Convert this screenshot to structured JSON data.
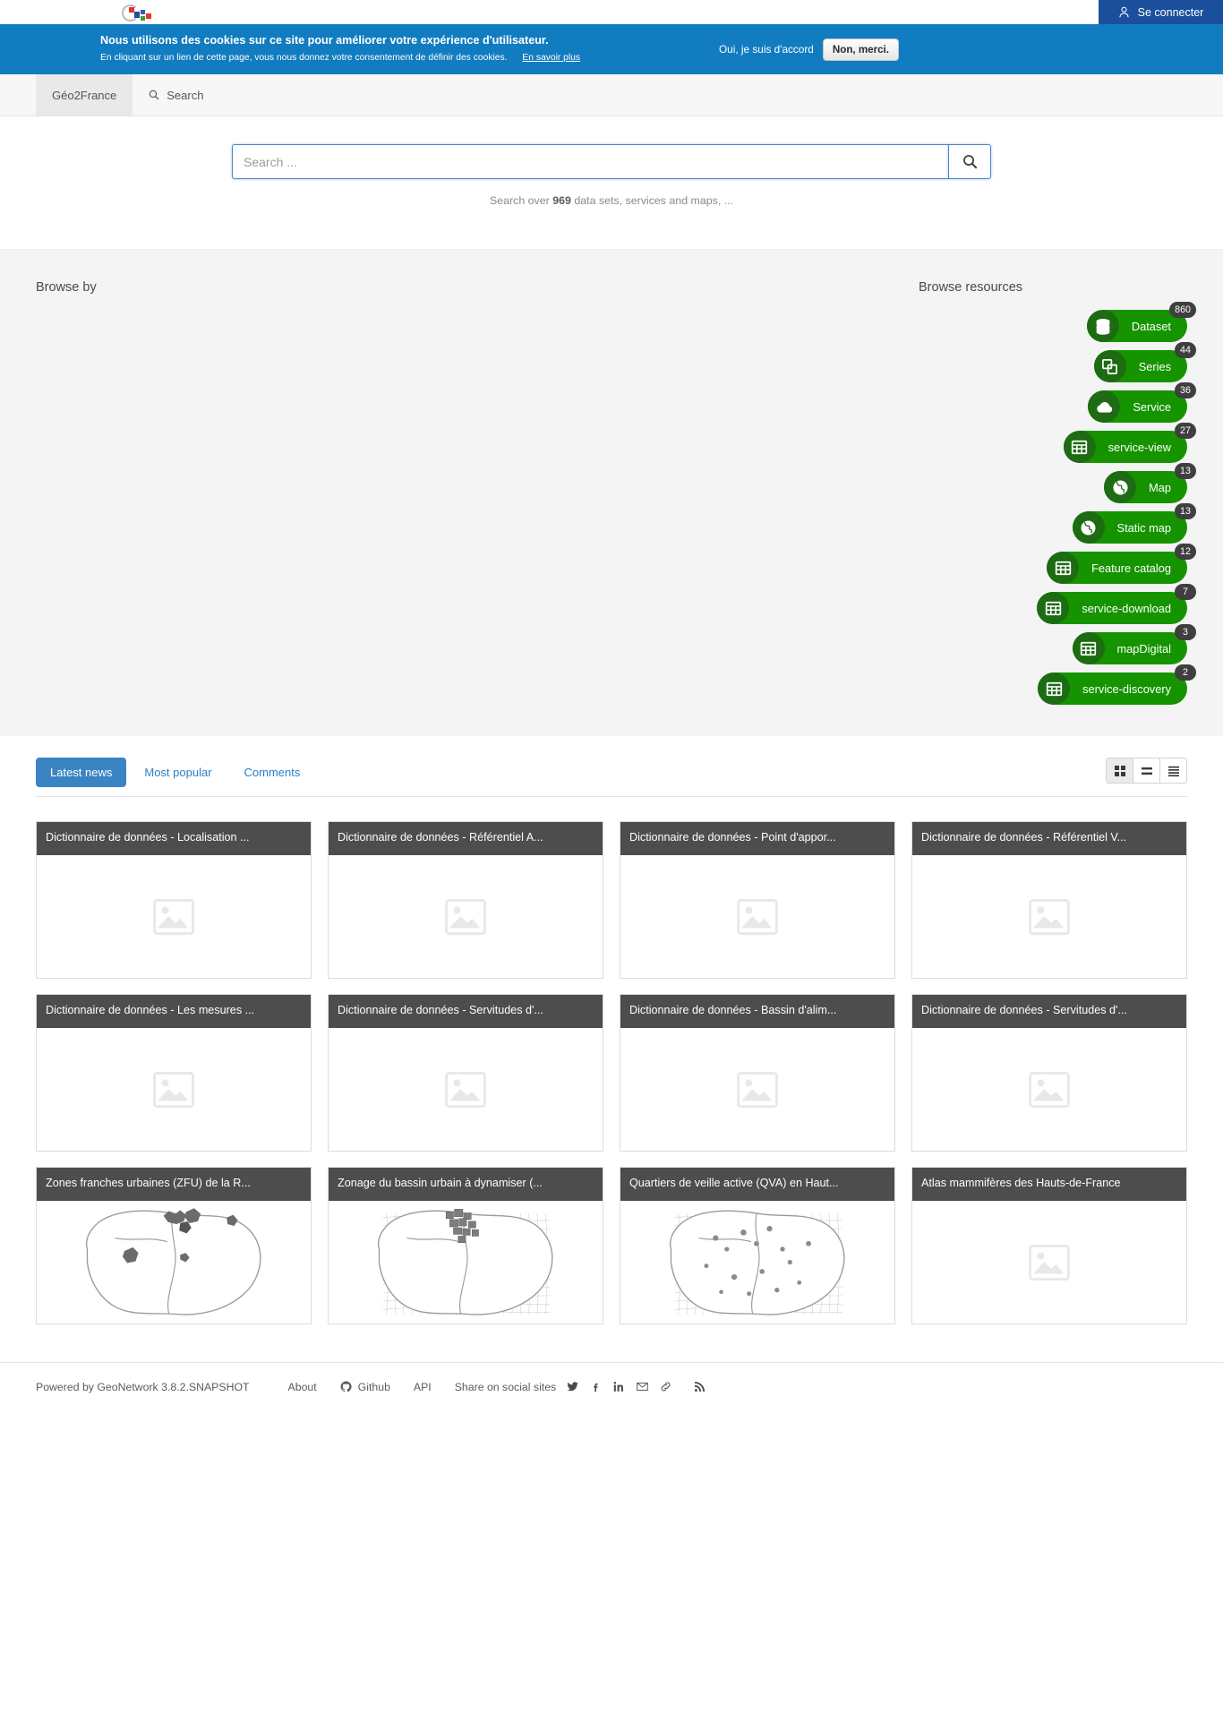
{
  "header": {
    "logo_alt": "Géo2France logo",
    "signin_label": "Se connecter"
  },
  "cookie_banner": {
    "title": "Nous utilisons des cookies sur ce site pour améliorer votre expérience d'utilisateur.",
    "subtitle": "En cliquant sur un lien de cette page, vous nous donnez votre consentement de définir des cookies.",
    "learn_more": "En savoir plus",
    "agree_label": "Oui, je suis d'accord",
    "deny_label": "Non, merci.",
    "background": "#127cc1"
  },
  "navbar": {
    "brand": "Géo2France",
    "search_item": "Search"
  },
  "search": {
    "placeholder": "Search ...",
    "value": "",
    "note_prefix": "Search over",
    "note_count": "969",
    "note_suffix": "data sets, services and maps, ..."
  },
  "browse": {
    "browse_by_title": "Browse by",
    "browse_resources_title": "Browse resources",
    "accent": "#159400",
    "icon_bg": "#1d6b13",
    "resources": [
      {
        "label": "Dataset",
        "count": "860",
        "icon": "database-icon"
      },
      {
        "label": "Series",
        "count": "44",
        "icon": "copy-icon"
      },
      {
        "label": "Service",
        "count": "36",
        "icon": "cloud-icon"
      },
      {
        "label": "service-view",
        "count": "27",
        "icon": "table-icon"
      },
      {
        "label": "Map",
        "count": "13",
        "icon": "globe-icon"
      },
      {
        "label": "Static map",
        "count": "13",
        "icon": "globe-icon"
      },
      {
        "label": "Feature catalog",
        "count": "12",
        "icon": "table-icon"
      },
      {
        "label": "service-download",
        "count": "7",
        "icon": "table-icon"
      },
      {
        "label": "mapDigital",
        "count": "3",
        "icon": "table-icon"
      },
      {
        "label": "service-discovery",
        "count": "2",
        "icon": "table-icon"
      }
    ]
  },
  "news": {
    "tabs": [
      {
        "label": "Latest news",
        "active": true
      },
      {
        "label": "Most popular",
        "active": false
      },
      {
        "label": "Comments",
        "active": false
      }
    ],
    "view_modes": [
      {
        "name": "grid-view",
        "active": true
      },
      {
        "name": "list-view",
        "active": false
      },
      {
        "name": "detail-view",
        "active": false
      }
    ],
    "cards": [
      {
        "title": "Dictionnaire de données - Localisation ...",
        "thumb": "placeholder"
      },
      {
        "title": "Dictionnaire de données - Référentiel A...",
        "thumb": "placeholder"
      },
      {
        "title": "Dictionnaire de données - Point d'appor...",
        "thumb": "placeholder"
      },
      {
        "title": "Dictionnaire de données - Référentiel V...",
        "thumb": "placeholder"
      },
      {
        "title": "Dictionnaire de données - Les mesures ...",
        "thumb": "placeholder"
      },
      {
        "title": "Dictionnaire de données - Servitudes d'...",
        "thumb": "placeholder"
      },
      {
        "title": "Dictionnaire de données - Bassin d'alim...",
        "thumb": "placeholder"
      },
      {
        "title": "Dictionnaire de données - Servitudes d'...",
        "thumb": "placeholder"
      },
      {
        "title": "Zones franches urbaines (ZFU) de la R...",
        "thumb": "map-zfu"
      },
      {
        "title": "Zonage du bassin urbain à dynamiser (...",
        "thumb": "map-bud"
      },
      {
        "title": "Quartiers de veille active (QVA) en Haut...",
        "thumb": "map-qva"
      },
      {
        "title": "Atlas mammifères des Hauts-de-France",
        "thumb": "placeholder"
      }
    ]
  },
  "footer": {
    "powered_by": "Powered by GeoNetwork 3.8.2.SNAPSHOT",
    "about": "About",
    "github": "Github",
    "api": "API",
    "share_label": "Share on social sites",
    "social": [
      "twitter-icon",
      "facebook-icon",
      "linkedin-icon",
      "email-icon",
      "permalink-icon",
      "rss-icon"
    ]
  }
}
